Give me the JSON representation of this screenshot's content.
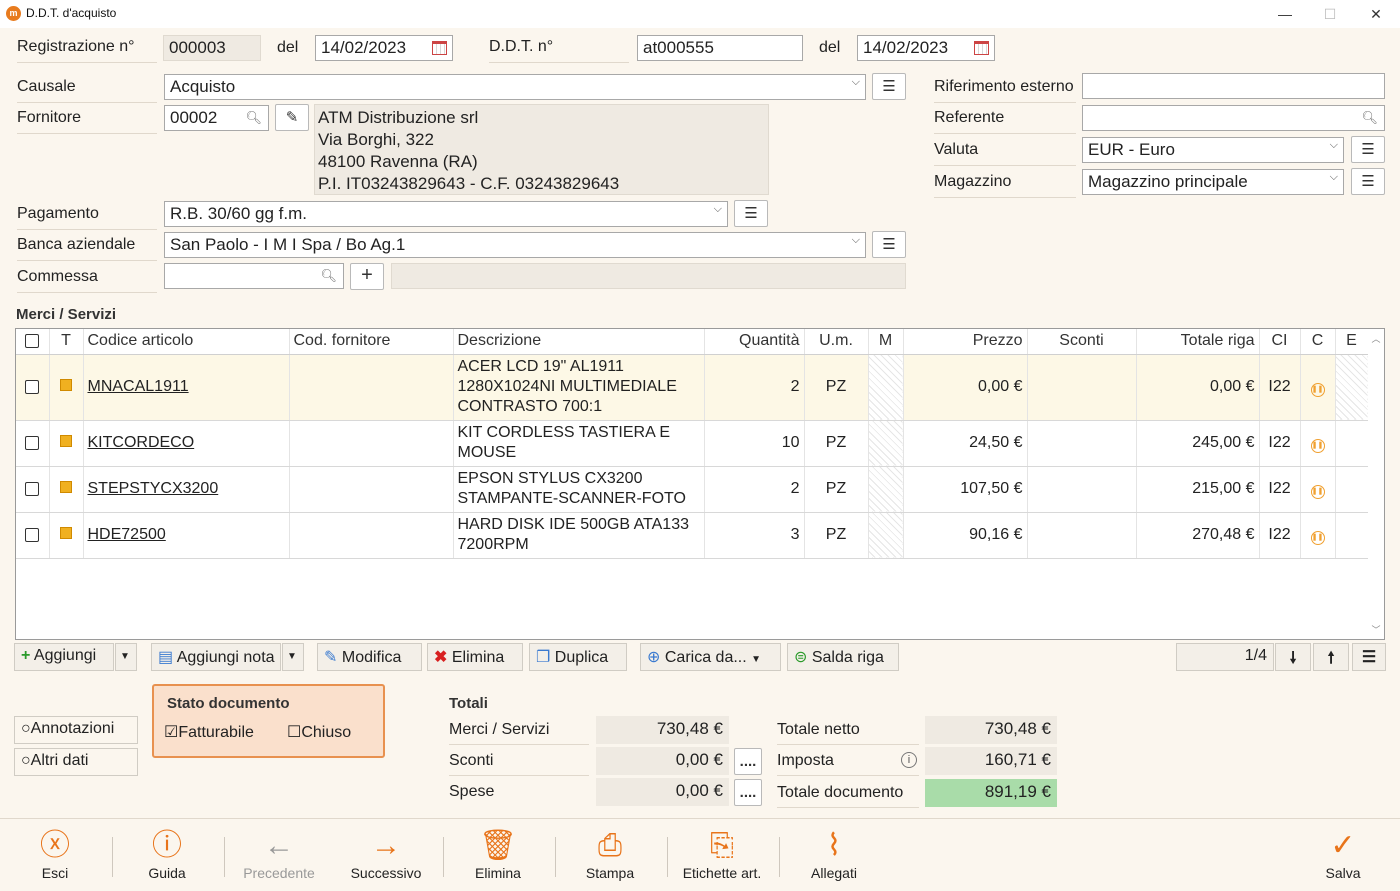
{
  "window": {
    "title": "D.D.T. d'acquisto",
    "minimize": "—",
    "maximize": "☐",
    "close": "✕"
  },
  "header": {
    "reg_label": "Registrazione n°",
    "reg_value": "000003",
    "del_label": "del",
    "reg_date": "14/02/2023",
    "ddt_label": "D.D.T. n°",
    "ddt_value": "at000555",
    "ddt_date": "14/02/2023"
  },
  "left": {
    "causale_label": "Causale",
    "causale_value": "Acquisto",
    "fornitore_label": "Fornitore",
    "fornitore_code": "00002",
    "fornitore_address": [
      "ATM Distribuzione srl",
      "Via Borghi, 322",
      "48100 Ravenna (RA)",
      "P.I. IT03243829643 - C.F. 03243829643"
    ],
    "pagamento_label": "Pagamento",
    "pagamento_value": "R.B. 30/60 gg f.m.",
    "banca_label": "Banca aziendale",
    "banca_value": "San Paolo - I M I Spa / Bo Ag.1",
    "commessa_label": "Commessa",
    "commessa_value": ""
  },
  "right": {
    "rif_label": "Riferimento esterno",
    "rif_value": "",
    "referente_label": "Referente",
    "referente_value": "",
    "valuta_label": "Valuta",
    "valuta_value": "EUR - Euro",
    "magazzino_label": "Magazzino",
    "magazzino_value": "Magazzino principale"
  },
  "grid": {
    "section_title": "Merci / Servizi",
    "columns": [
      "T",
      "Codice articolo",
      "Cod. fornitore",
      "Descrizione",
      "Quantità",
      "U.m.",
      "M",
      "Prezzo",
      "Sconti",
      "Totale riga",
      "CI",
      "C",
      "E"
    ],
    "rows": [
      {
        "code": "MNACAL1911",
        "supplier_code": "",
        "description": "ACER LCD 19\" AL1911 1280X1024NI MULTIMEDIALE CONTRASTO 700:1",
        "qty": "2",
        "um": "PZ",
        "price": "0,00 €",
        "discount": "",
        "total": "0,00 €",
        "ci": "I22"
      },
      {
        "code": "KITCORDECO",
        "supplier_code": "",
        "description": "KIT CORDLESS TASTIERA E MOUSE",
        "qty": "10",
        "um": "PZ",
        "price": "24,50 €",
        "discount": "",
        "total": "245,00 €",
        "ci": "I22"
      },
      {
        "code": "STEPSTYCX3200",
        "supplier_code": "",
        "description": "EPSON STYLUS CX3200 STAMPANTE-SCANNER-FOTO",
        "qty": "2",
        "um": "PZ",
        "price": "107,50 €",
        "discount": "",
        "total": "215,00 €",
        "ci": "I22"
      },
      {
        "code": "HDE72500",
        "supplier_code": "",
        "description": "HARD DISK IDE 500GB ATA133 7200RPM",
        "qty": "3",
        "um": "PZ",
        "price": "90,16 €",
        "discount": "",
        "total": "270,48 €",
        "ci": "I22"
      }
    ]
  },
  "toolbar": {
    "aggiungi": "Aggiungi",
    "aggiungi_nota": "Aggiungi nota",
    "modifica": "Modifica",
    "elimina": "Elimina",
    "duplica": "Duplica",
    "carica_da": "Carica da...",
    "salda_riga": "Salda riga",
    "pager": "1/4"
  },
  "side_options": {
    "annotazioni": "Annotazioni",
    "altri_dati": "Altri dati"
  },
  "stato": {
    "title": "Stato documento",
    "fatturabile": "Fatturabile",
    "chiuso": "Chiuso",
    "fatturabile_checked": true,
    "chiuso_checked": false
  },
  "totali": {
    "title": "Totali",
    "merci_label": "Merci / Servizi",
    "merci_value": "730,48 €",
    "sconti_label": "Sconti",
    "sconti_value": "0,00 €",
    "spese_label": "Spese",
    "spese_value": "0,00 €",
    "netto_label": "Totale netto",
    "netto_value": "730,48 €",
    "imposta_label": "Imposta",
    "imposta_value": "160,71 €",
    "documento_label": "Totale documento",
    "documento_value": "891,19 €",
    "dots": "....",
    "accent": "#a9dca9"
  },
  "bottom": {
    "esci": "Esci",
    "guida": "Guida",
    "precedente": "Precedente",
    "successivo": "Successivo",
    "elimina": "Elimina",
    "stampa": "Stampa",
    "etichette": "Etichette art.",
    "allegati": "Allegati",
    "salva": "Salva",
    "accent": "#e8741a"
  }
}
